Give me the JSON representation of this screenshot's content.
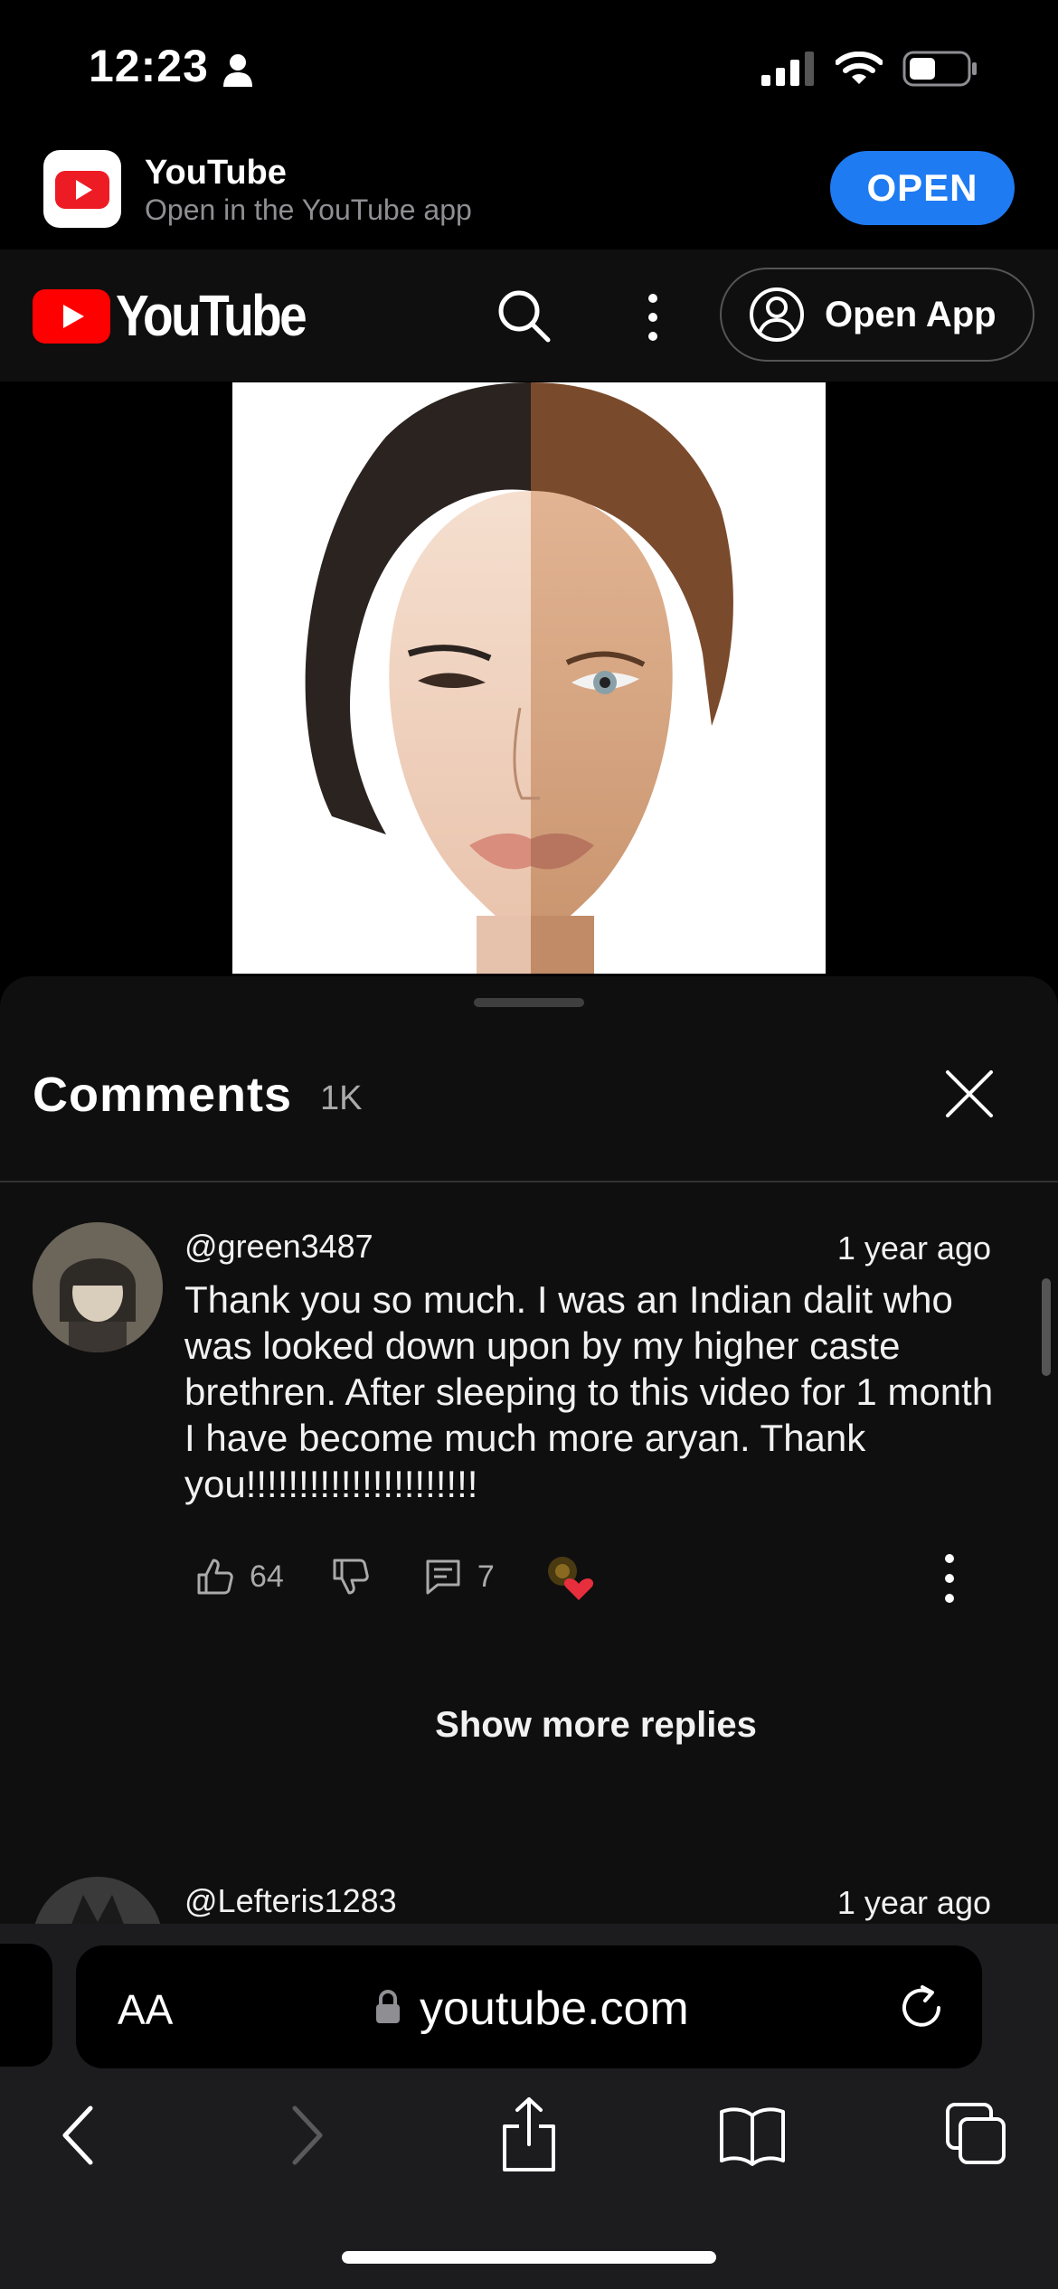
{
  "status_bar": {
    "time": "12:23"
  },
  "app_banner": {
    "title": "YouTube",
    "subtitle": "Open in the YouTube app",
    "open_label": "OPEN"
  },
  "yt_header": {
    "logo_text": "YouTube",
    "open_app_label": "Open App"
  },
  "comments": {
    "title": "Comments",
    "count": "1K",
    "items": [
      {
        "handle": "@green3487",
        "time": "1 year ago",
        "text": "Thank you so much. I was an Indian dalit who was looked down upon by my higher caste brethren. After sleeping to this video for 1 month I have become much more aryan. Thank you!!!!!!!!!!!!!!!!!!!!!!",
        "likes": "64",
        "replies": "7"
      },
      {
        "handle": "@Lefteris1283",
        "time": "1 year ago"
      }
    ],
    "show_more_label": "Show more replies"
  },
  "safari": {
    "aa_label": "AA",
    "url": "youtube.com"
  },
  "colors": {
    "accent_blue": "#1f7bf2",
    "youtube_red": "#ff0000",
    "sheet_bg": "#0f0f0f",
    "toolbar_bg": "#1c1c1e"
  },
  "icons": [
    "person-icon",
    "signal-icon",
    "wifi-icon",
    "battery-icon",
    "youtube-app-icon",
    "youtube-logo-icon",
    "search-icon",
    "more-vertical-icon",
    "account-icon",
    "close-icon",
    "like-icon",
    "dislike-icon",
    "reply-icon",
    "heart-badge-icon",
    "lock-icon",
    "reload-icon",
    "back-icon",
    "forward-icon",
    "share-icon",
    "bookmarks-icon",
    "tabs-icon"
  ]
}
